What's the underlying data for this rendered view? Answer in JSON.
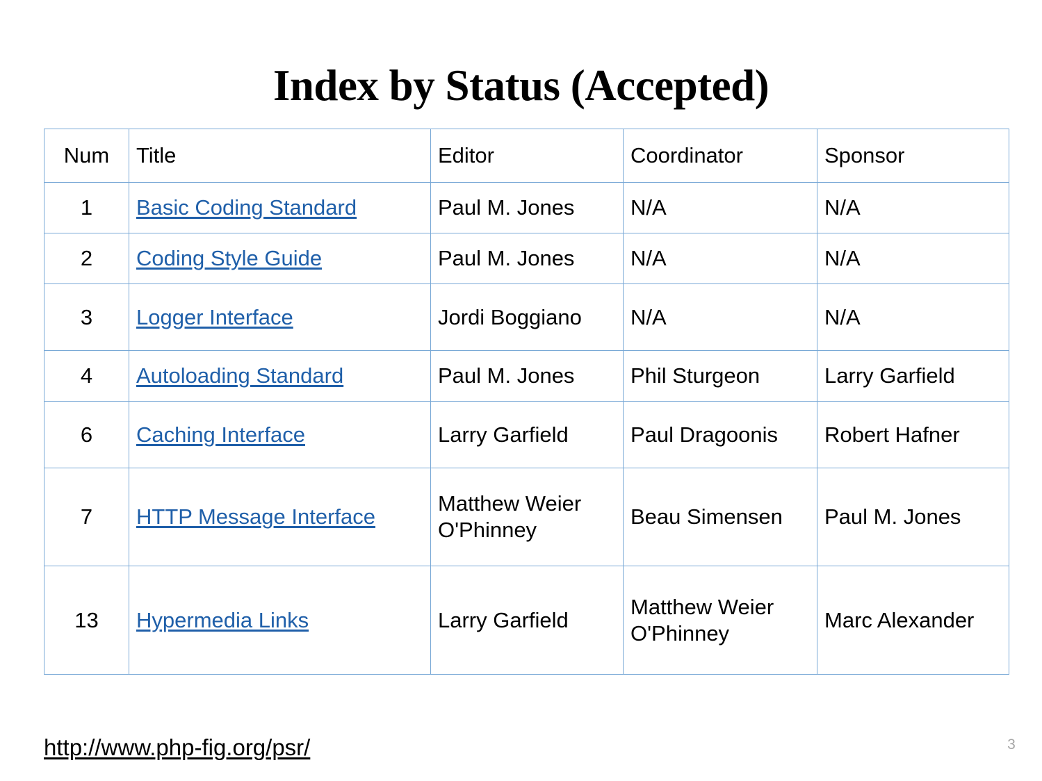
{
  "slide": {
    "title": "Index by Status (Accepted)",
    "page_number": "3",
    "footer_link": "http://www.php-fig.org/psr/",
    "colors": {
      "table_border": "#78A8D6",
      "link_blue": "#1F5FA9",
      "text": "#000000",
      "page_number": "#A6A6A6",
      "background": "#FFFFFF"
    }
  },
  "table": {
    "headers": {
      "num": "Num",
      "title": "Title",
      "editor": "Editor",
      "coordinator": "Coordinator",
      "sponsor": "Sponsor"
    },
    "rows": [
      {
        "num": "1",
        "title": "Basic Coding Standard",
        "title_is_link": true,
        "editor": "Paul M. Jones",
        "coordinator": "N/A",
        "sponsor": "N/A"
      },
      {
        "num": "2",
        "title": "Coding Style Guide",
        "title_is_link": true,
        "editor": "Paul M. Jones",
        "coordinator": "N/A",
        "sponsor": "N/A"
      },
      {
        "num": "3",
        "title": "Logger Interface",
        "title_is_link": true,
        "editor": "Jordi Boggiano",
        "coordinator": "N/A",
        "sponsor": "N/A"
      },
      {
        "num": "4",
        "title": "Autoloading Standard",
        "title_is_link": true,
        "editor": "Paul M. Jones",
        "coordinator": "Phil Sturgeon",
        "sponsor": "Larry Garfield"
      },
      {
        "num": "6",
        "title": "Caching Interface",
        "title_is_link": true,
        "editor": "Larry Garfield",
        "coordinator": "Paul Dragoonis",
        "sponsor": "Robert Hafner"
      },
      {
        "num": "7",
        "title": "HTTP Message Interface",
        "title_is_link": true,
        "editor": "Matthew Weier O'Phinney",
        "coordinator": "Beau Simensen",
        "sponsor": "Paul M. Jones"
      },
      {
        "num": "13",
        "title": "Hypermedia Links",
        "title_is_link": true,
        "editor": "Larry Garfield",
        "coordinator": "Matthew Weier O'Phinney",
        "sponsor": "Marc Alexander"
      }
    ]
  }
}
